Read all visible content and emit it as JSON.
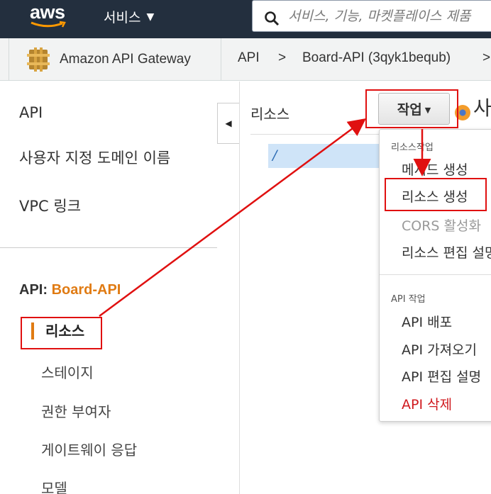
{
  "topbar": {
    "logo": "aws",
    "services_label": "서비스",
    "search_placeholder": "서비스, 기능, 마켓플레이스 제품"
  },
  "breadcrumb": {
    "home_label": "Amazon API Gateway",
    "items": [
      "API",
      ">",
      "Board-API (3qyk1bequb)",
      ">"
    ]
  },
  "leftnav": {
    "top_items": [
      "API",
      "사용자 지정 도메인 이름",
      "VPC 링크"
    ],
    "api_prefix": "API:",
    "api_name": "Board-API",
    "active_item": "리소스",
    "sub_items": [
      "스테이지",
      "권한 부여자",
      "게이트웨이 응답",
      "모델"
    ]
  },
  "main": {
    "resources_header": "리소스",
    "root_resource": "/",
    "actions_button": "작업",
    "cut_heading": "사"
  },
  "dropdown": {
    "group1_label": "리소스작업",
    "group1_items": [
      "메서드 생성",
      "리소스 생성",
      "CORS 활성화",
      "리소스 편집 설명"
    ],
    "group2_label": "API 작업",
    "group2_items": [
      "API 배포",
      "API 가져오기",
      "API 편집 설명",
      "API 삭제"
    ]
  },
  "colors": {
    "topbar": "#232f3e",
    "accent_orange": "#e07b13",
    "highlight_red": "#e01010",
    "selected_blue": "#cfe4f8",
    "danger": "#d0191e"
  }
}
